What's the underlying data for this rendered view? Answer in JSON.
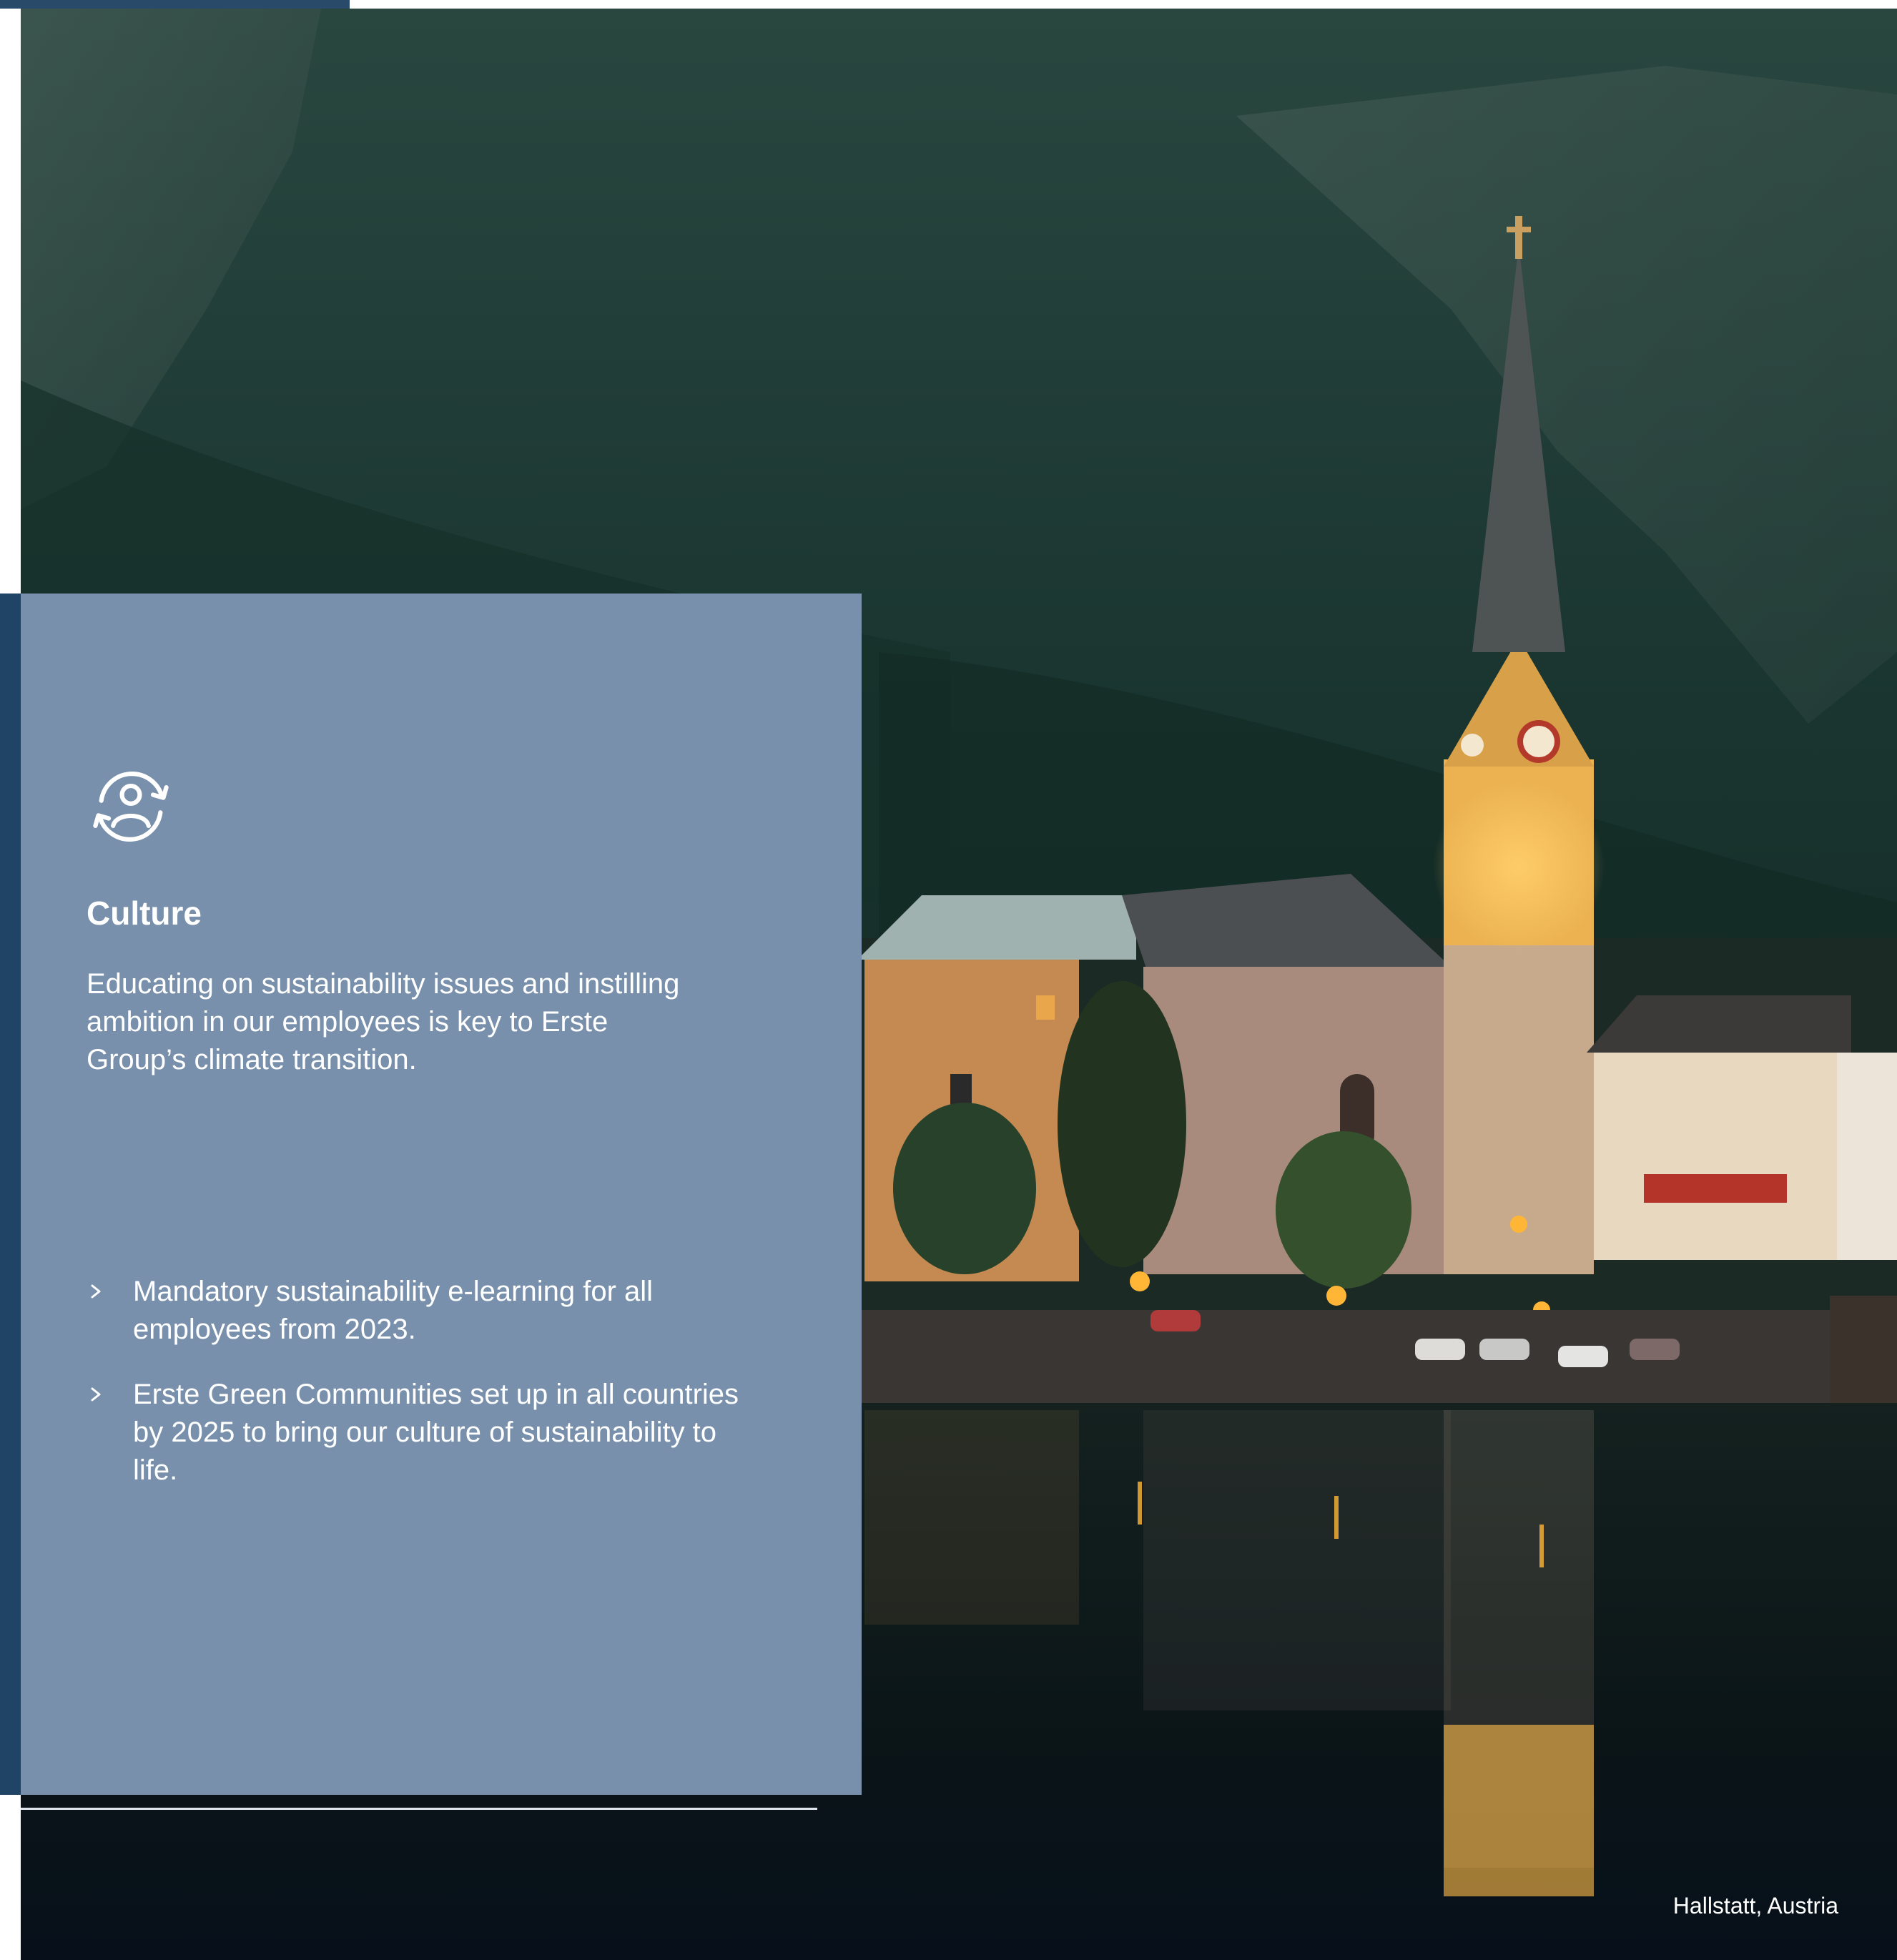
{
  "panel": {
    "icon": "person-refresh-icon",
    "title": "Culture",
    "lead": "Educating on sustainability issues and instilling ambition in our employees is key to Erste Group’s climate transition.",
    "bullets": [
      "Mandatory sustainability e-learning for all employees from 2023.",
      "Erste Green Communities set up in all countries by 2025 to bring our culture of sustainability to life."
    ],
    "bullet_icon": "chevron-right-icon"
  },
  "photo": {
    "caption": "Hallstatt, Austria"
  },
  "colors": {
    "panel_bg": "#7890ab",
    "accent_dark_blue": "#1f4466",
    "text": "#ffffff"
  }
}
